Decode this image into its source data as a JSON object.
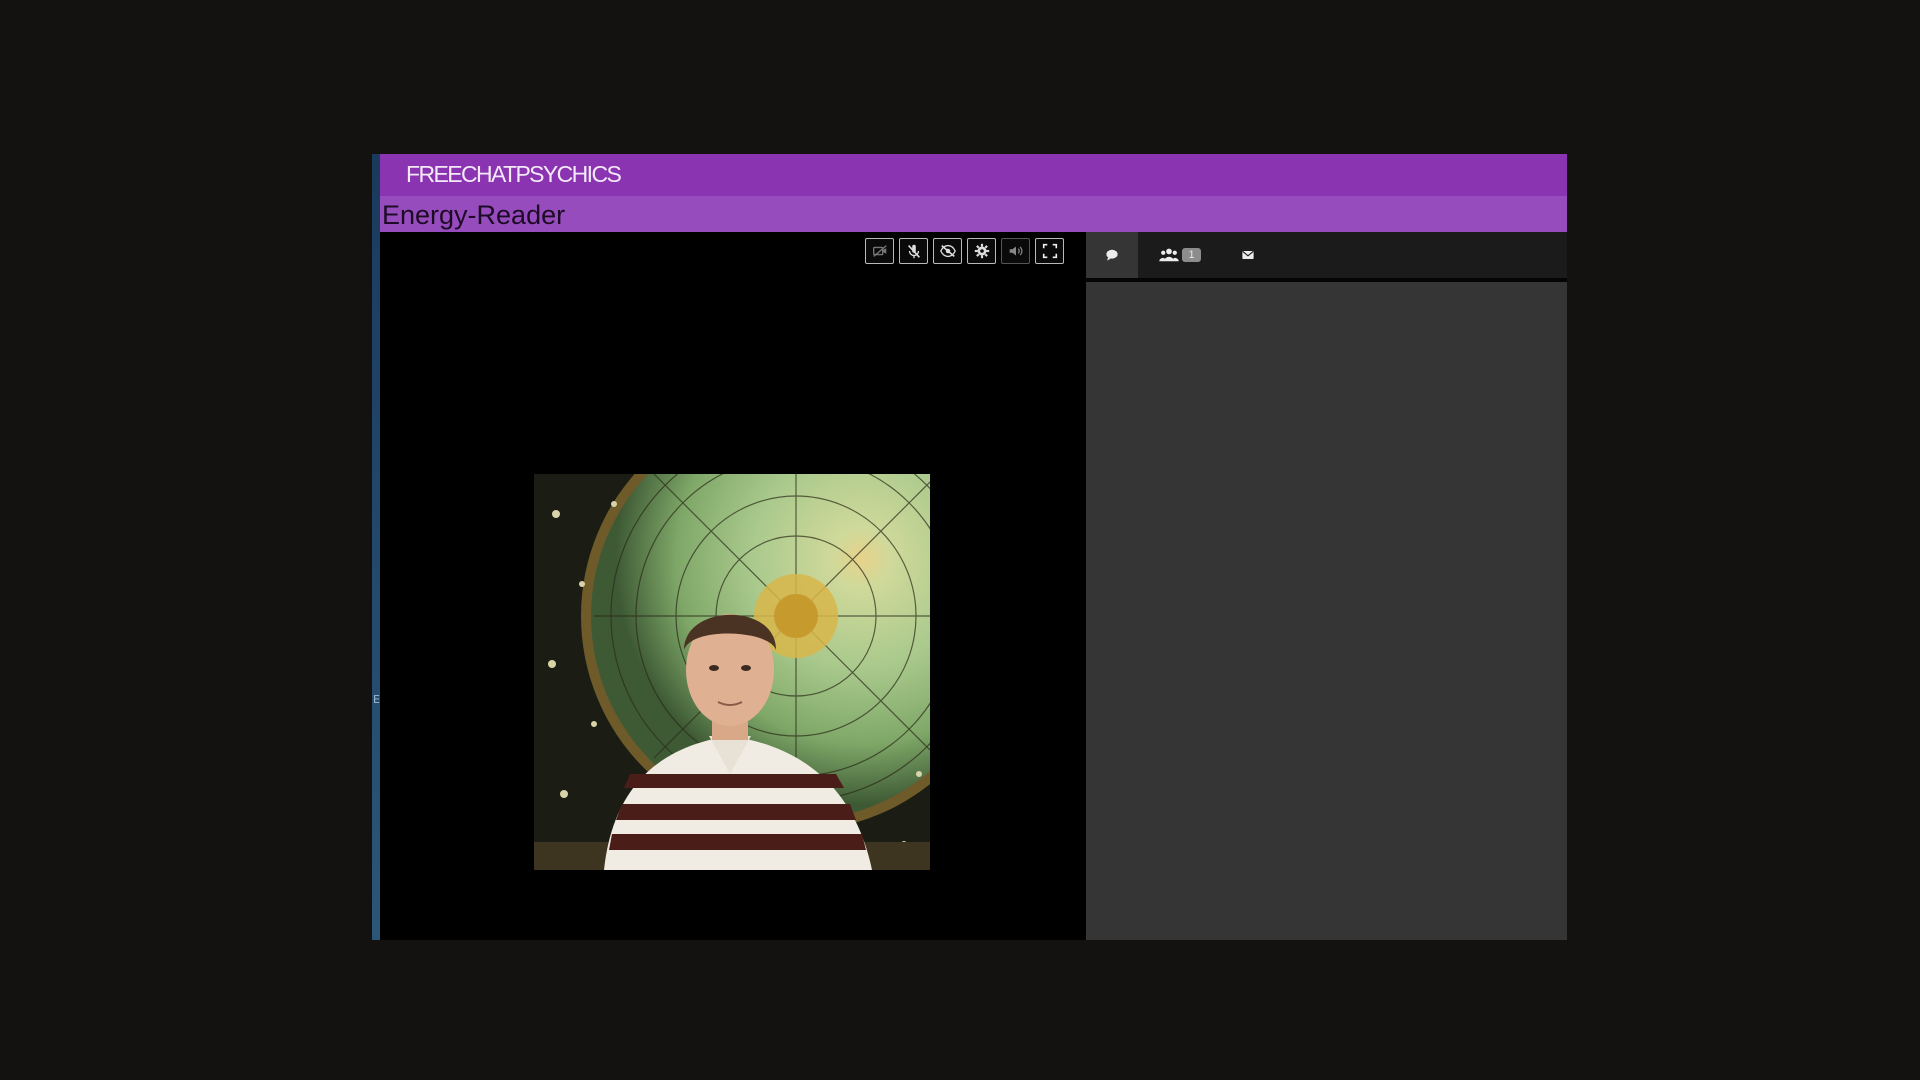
{
  "brand": {
    "logo_text": "FREECHATPSYCHICS"
  },
  "reader": {
    "name": "Energy-Reader"
  },
  "side_marker": "E",
  "video_controls": [
    {
      "icon": "camera-off-icon"
    },
    {
      "icon": "mic-off-icon"
    },
    {
      "icon": "eye-off-icon"
    },
    {
      "icon": "gear-icon"
    },
    {
      "icon": "volume-icon"
    },
    {
      "icon": "fullscreen-icon"
    }
  ],
  "chat_tabs": [
    {
      "icon": "chat-bubble-icon",
      "active": true
    },
    {
      "icon": "users-icon",
      "badge": "1"
    },
    {
      "icon": "envelope-icon"
    }
  ],
  "colors": {
    "brand_bar": "#8b34b1",
    "title_bar": "#974cbd",
    "chat_panel": "#353535",
    "background": "#141111"
  }
}
